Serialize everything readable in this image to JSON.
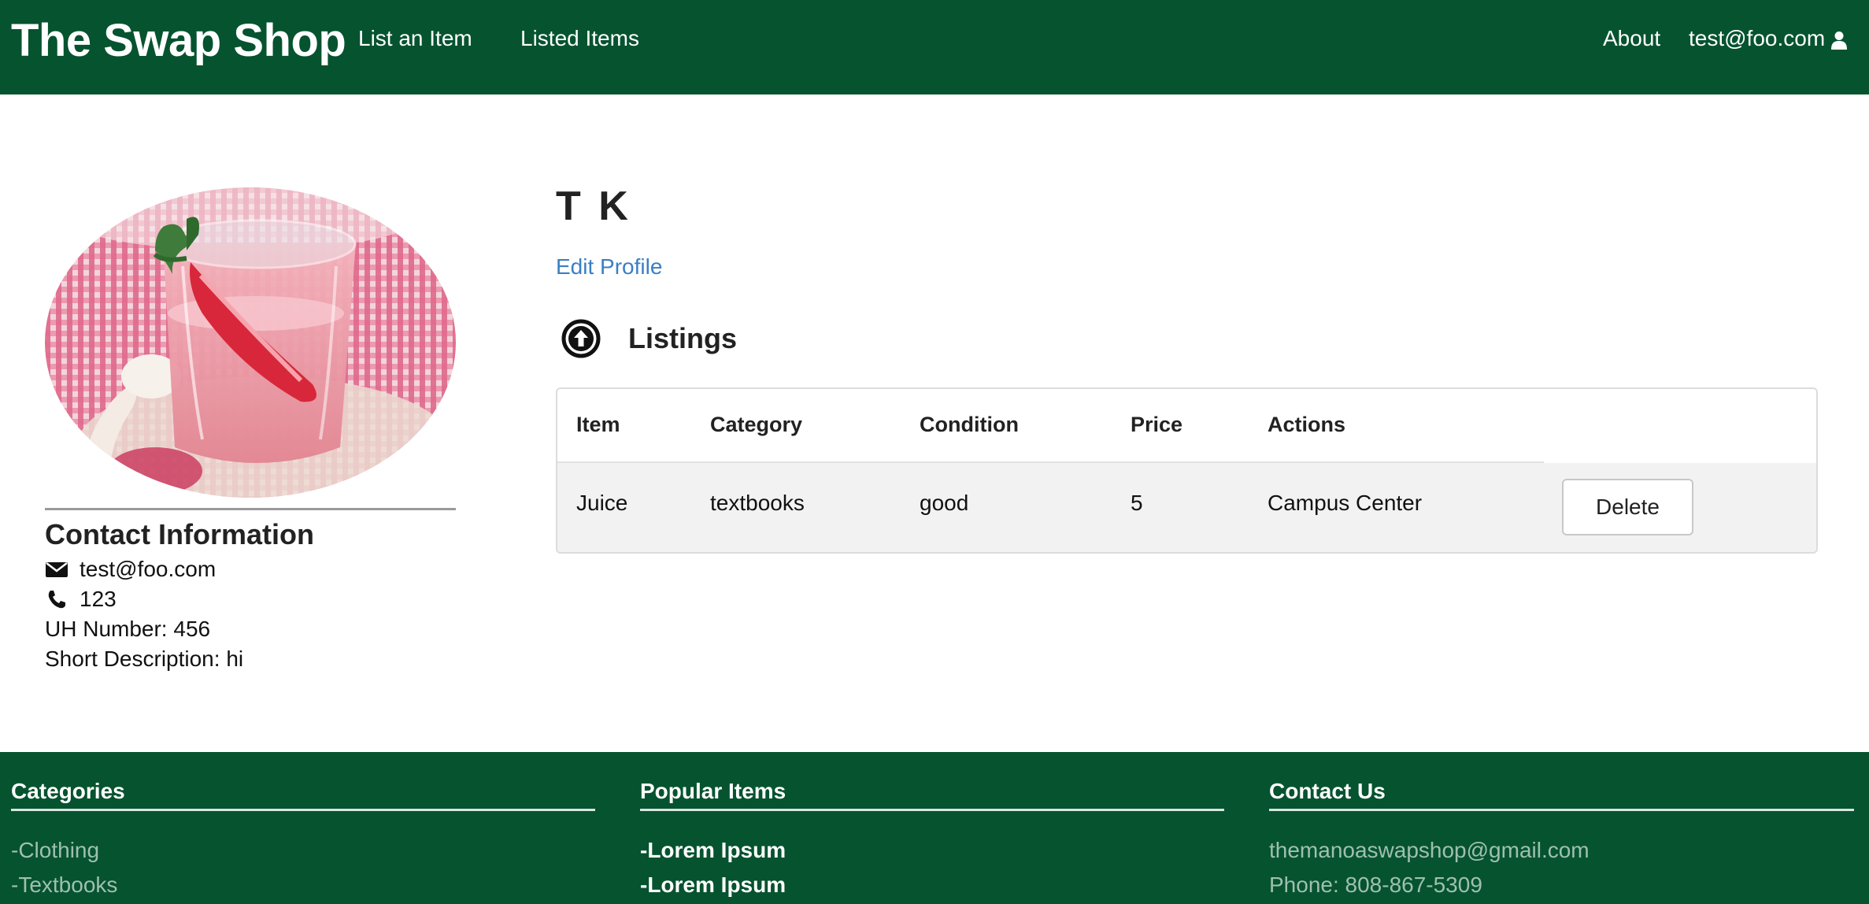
{
  "navbar": {
    "brand": "The Swap Shop",
    "list_item": "List an Item",
    "listed_items": "Listed Items",
    "about": "About",
    "user_email": "test@foo.com",
    "user_icon": "user-icon",
    "bg_color": "#06532f"
  },
  "profile": {
    "avatar_alt": "strawberry smoothie photo",
    "contact_title": "Contact Information",
    "email": "test@foo.com",
    "phone": "123",
    "uh_number": "UH Number: 456",
    "short_description": "Short Description: hi",
    "email_icon": "envelope-icon",
    "phone_icon": "phone-icon"
  },
  "main": {
    "name": "T K",
    "edit_profile": "Edit Profile",
    "listings_title": "Listings",
    "listings_icon": "arrow-circle-up-icon",
    "link_color": "#3a7fc4"
  },
  "table": {
    "headers": {
      "item": "Item",
      "category": "Category",
      "condition": "Condition",
      "price": "Price",
      "actions": "Actions"
    },
    "rows": [
      {
        "item": "Juice",
        "category": "textbooks",
        "condition": "good",
        "price": "5",
        "location": "Campus Center",
        "delete_label": "Delete"
      }
    ]
  },
  "footer": {
    "categories": {
      "title": "Categories",
      "items": [
        "-Clothing",
        "-Textbooks"
      ]
    },
    "popular": {
      "title": "Popular Items",
      "items": [
        "-Lorem Ipsum",
        "-Lorem Ipsum"
      ]
    },
    "contact": {
      "title": "Contact Us",
      "email": "themanoaswapshop@gmail.com",
      "phone": "Phone: 808-867-5309"
    }
  }
}
